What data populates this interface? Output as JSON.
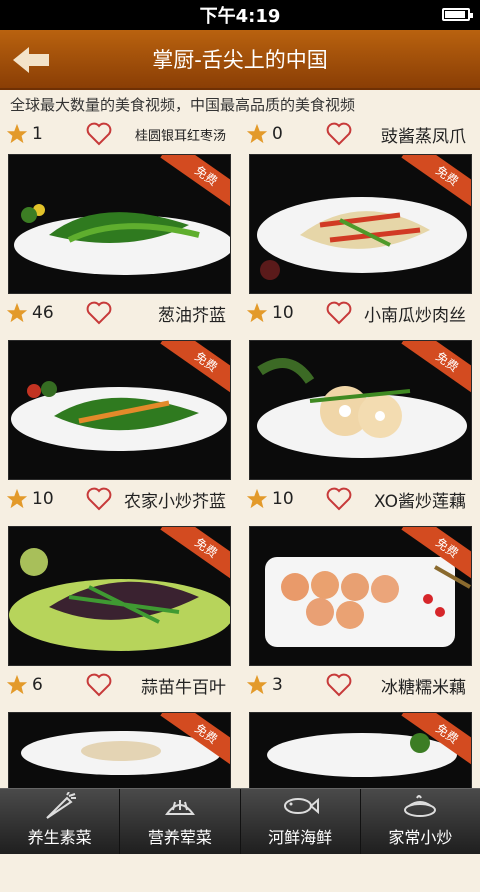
{
  "status": {
    "time": "下午4:19"
  },
  "header": {
    "title": "掌厨-舌尖上的中国"
  },
  "tagline": "全球最大数量的美食视频，中国最高品质的美食视频",
  "top_row": [
    {
      "count": "1",
      "name": "桂圆银耳红枣汤"
    },
    {
      "count": "0",
      "name": "豉酱蒸凤爪"
    }
  ],
  "badge_label": "免费",
  "dishes": [
    {
      "count": "46",
      "name": "葱油芥蓝"
    },
    {
      "count": "10",
      "name": "小南瓜炒肉丝"
    },
    {
      "count": "10",
      "name": "农家小炒芥蓝"
    },
    {
      "count": "10",
      "name": "XO酱炒莲藕"
    },
    {
      "count": "6",
      "name": "蒜苗牛百叶"
    },
    {
      "count": "3",
      "name": "冰糖糯米藕"
    },
    {
      "count": "",
      "name": ""
    },
    {
      "count": "",
      "name": ""
    }
  ],
  "bottom_tabs": [
    {
      "label": "养生素菜",
      "icon": "carrot-icon"
    },
    {
      "label": "营养荤菜",
      "icon": "meat-icon"
    },
    {
      "label": "河鲜海鲜",
      "icon": "fish-icon"
    },
    {
      "label": "家常小炒",
      "icon": "pot-icon"
    }
  ],
  "colors": {
    "accent": "#a8550b",
    "background": "#f6efe2",
    "star": "#e39a2a",
    "heart": "#c73a3a"
  }
}
